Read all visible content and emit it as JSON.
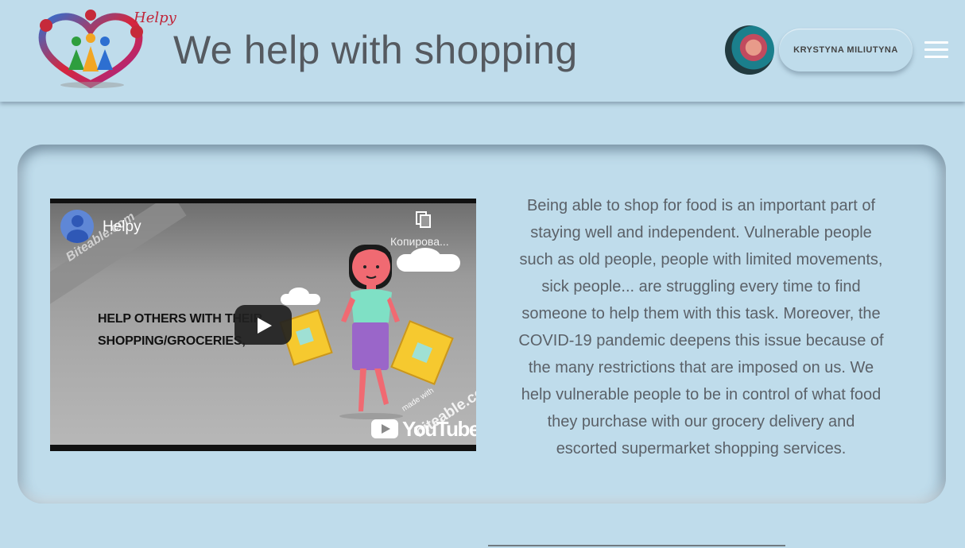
{
  "header": {
    "logo_text": "Helpy",
    "title": "We help with shopping",
    "user_name": "KRYSTYNA MILIUTYNA",
    "avatar_icon": "avatar",
    "menu_icon": "hamburger-menu-icon"
  },
  "video": {
    "channel_title": "Helpy",
    "copy_label": "Копирова...",
    "watermark": "Biteable.com",
    "caption_line1": "HELP OTHERS WITH THEIR",
    "caption_line2": "SHOPPING/GROCERIES,",
    "made_with": "made with",
    "brand_watermark": "biteable.com",
    "youtube_label": "YouTube"
  },
  "description": "Being able to shop for food is an important part of staying well and independent. Vulnerable people such as old people, people with limited movements, sick people... are struggling every time to find someone to help them with this task. Moreover, the COVID-19 pandemic deepens this issue because of the many restrictions that are imposed on us. We help vulnerable people to be in control of what food they purchase with our grocery delivery and escorted supermarket shopping services.",
  "colors": {
    "background": "#bfdceb",
    "title_text": "#555a60",
    "logo_red": "#c0263a"
  }
}
